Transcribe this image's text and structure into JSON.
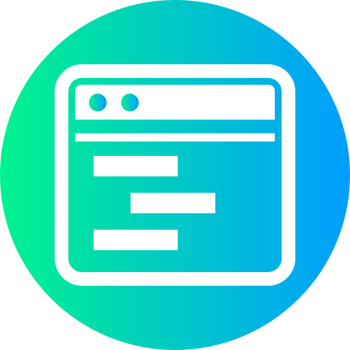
{
  "icon": {
    "name": "browser-window-code-icon",
    "gradient_start": "#00f38d",
    "gradient_end": "#009eff",
    "foreground": "#ffffff"
  }
}
